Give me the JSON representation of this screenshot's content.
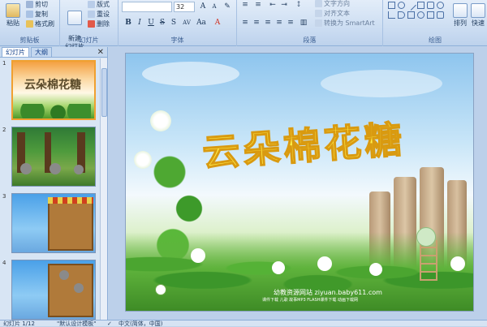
{
  "ribbon": {
    "clipboard": {
      "paste_label": "粘贴",
      "cut_label": "剪切",
      "copy_label": "复制",
      "format_painter_label": "格式刷",
      "group_label": "剪贴板"
    },
    "slides": {
      "new_slide_label": "新建\n幻灯片",
      "layout_label": "版式",
      "reset_label": "重设",
      "delete_label": "删除",
      "group_label": "幻灯片"
    },
    "font": {
      "font_name_value": "",
      "font_size_value": "32",
      "group_label": "字体"
    },
    "paragraph": {
      "text_direction_label": "文字方向",
      "align_text_label": "对齐文本",
      "smartart_label": "转换为 SmartArt",
      "group_label": "段落"
    },
    "drawing": {
      "arrange_label": "排列",
      "quick_styles_label": "快速",
      "group_label": "绘图"
    }
  },
  "left_panel": {
    "tab_slides": "幻灯片",
    "tab_outline": "大纲",
    "close": "✕",
    "thumbnails": [
      {
        "number": "1",
        "caption": "云朵棉花糖"
      },
      {
        "number": "2",
        "caption": ""
      },
      {
        "number": "3",
        "caption": ""
      },
      {
        "number": "4",
        "caption": ""
      }
    ]
  },
  "slide": {
    "title": "云朵棉花糖",
    "footer_site": "幼教资源网站  ziyuan.baby611.com",
    "footer_sub": "课件下载  儿歌  故事MP3  FLASH课件下载  动画下载网"
  },
  "status_bar": {
    "slide_count": "幻灯片 1/12",
    "theme": "\"默认设计模板\"",
    "language": "中文(简体，中国)"
  },
  "colors": {
    "title_fill": "#fff14a",
    "title_stroke": "#d99a10",
    "ribbon_bg": "#c9dbf1",
    "selection": "#f0a030"
  }
}
